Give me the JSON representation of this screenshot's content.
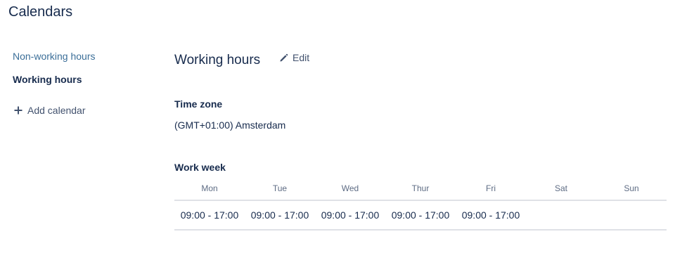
{
  "page": {
    "title": "Calendars"
  },
  "sidebar": {
    "items": [
      {
        "label": "Non-working hours",
        "active": false
      },
      {
        "label": "Working hours",
        "active": true
      }
    ],
    "add_calendar": {
      "label": "Add calendar",
      "icon": "plus-icon"
    }
  },
  "main": {
    "heading": "Working hours",
    "edit": {
      "label": "Edit",
      "icon": "pencil-icon"
    },
    "time_zone": {
      "label": "Time zone",
      "value": "(GMT+01:00) Amsterdam"
    },
    "work_week": {
      "label": "Work week",
      "days": [
        "Mon",
        "Tue",
        "Wed",
        "Thur",
        "Fri",
        "Sat",
        "Sun"
      ],
      "hours": [
        "09:00 - 17:00",
        "09:00 - 17:00",
        "09:00 - 17:00",
        "09:00 - 17:00",
        "09:00 - 17:00",
        "",
        ""
      ]
    }
  },
  "colors": {
    "text_primary": "#172b4d",
    "text_secondary": "#5e6c84",
    "link": "#3b6e98",
    "divider": "#dfe1e6"
  }
}
